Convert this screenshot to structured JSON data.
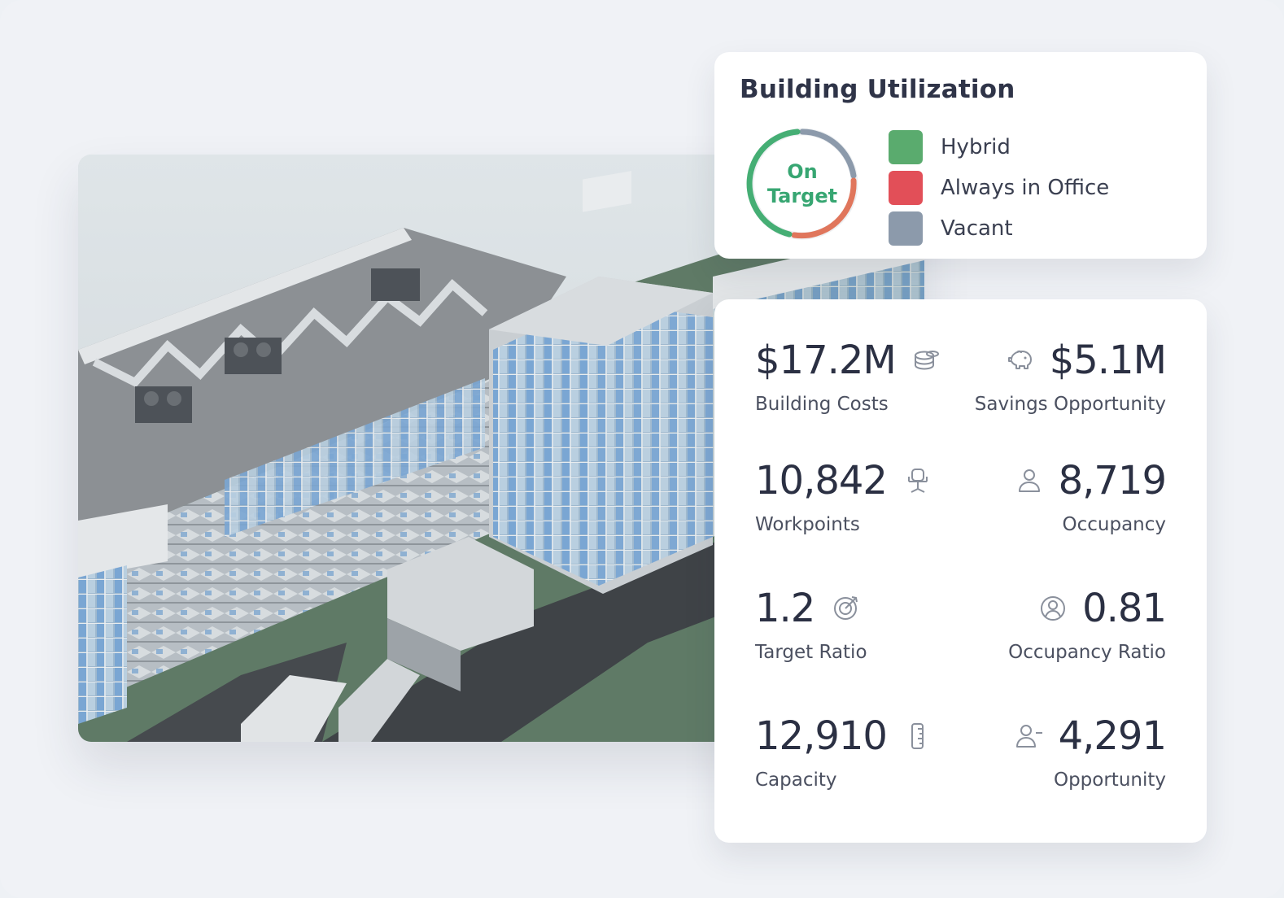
{
  "utilization": {
    "title": "Building Utilization",
    "status_line1": "On",
    "status_line2": "Target",
    "status_color": "#37a672",
    "legend": [
      {
        "label": "Hybrid",
        "color": "#5aab6e"
      },
      {
        "label": "Always in Office",
        "color": "#e24f58"
      },
      {
        "label": "Vacant",
        "color": "#8c9aab"
      }
    ]
  },
  "kpis": {
    "building_costs": {
      "value": "$17.2M",
      "label": "Building Costs",
      "icon": "coins-icon"
    },
    "savings": {
      "value": "$5.1M",
      "label": "Savings Opportunity",
      "icon": "piggy-bank-icon"
    },
    "workpoints": {
      "value": "10,842",
      "label": "Workpoints",
      "icon": "office-chair-icon"
    },
    "occupancy": {
      "value": "8,719",
      "label": "Occupancy",
      "icon": "person-icon"
    },
    "target_ratio": {
      "value": "1.2",
      "label": "Target Ratio",
      "icon": "target-icon"
    },
    "occupancy_ratio": {
      "value": "0.81",
      "label": "Occupancy Ratio",
      "icon": "user-circle-icon"
    },
    "capacity": {
      "value": "12,910",
      "label": "Capacity",
      "icon": "ruler-icon"
    },
    "opportunity": {
      "value": "4,291",
      "label": "Opportunity",
      "icon": "person-minus-icon"
    }
  }
}
